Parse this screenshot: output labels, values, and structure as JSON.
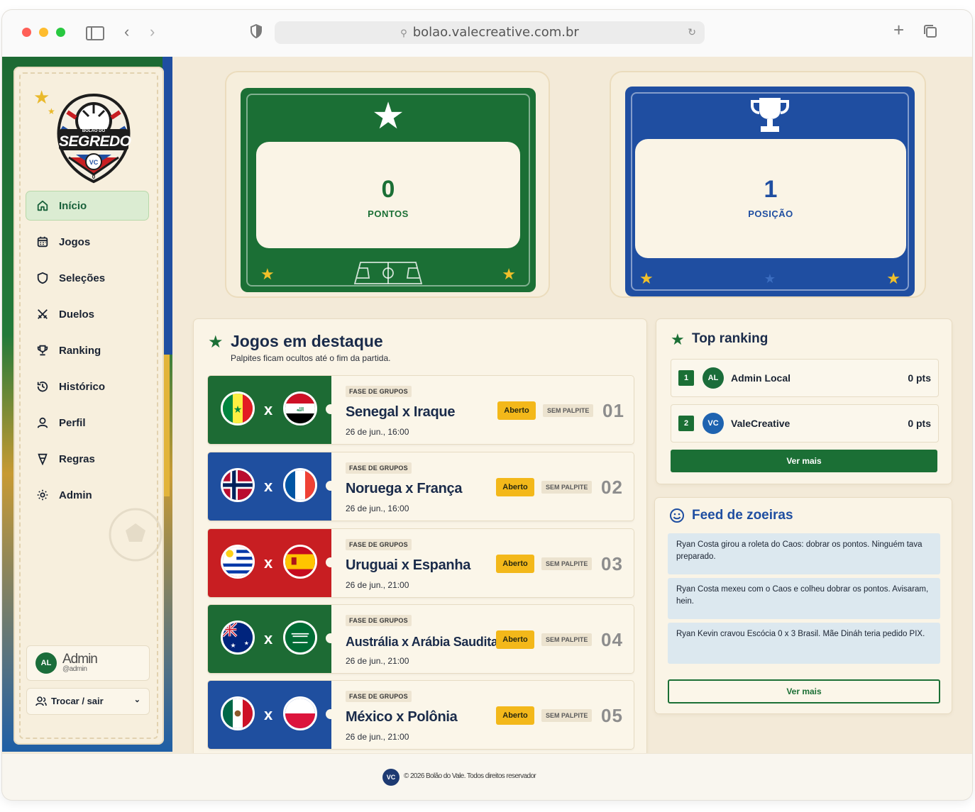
{
  "browser": {
    "url": "bolao.valecreative.com.br"
  },
  "brand": {
    "logo_text": "SEGREDO",
    "logo_top_text": "BOLÃO DO"
  },
  "sidebar": {
    "items": [
      {
        "label": "Início",
        "icon": "home-icon",
        "active": true
      },
      {
        "label": "Jogos",
        "icon": "calendar-icon"
      },
      {
        "label": "Seleções",
        "icon": "shield-icon"
      },
      {
        "label": "Duelos",
        "icon": "swords-icon"
      },
      {
        "label": "Ranking",
        "icon": "trophy-icon"
      },
      {
        "label": "Histórico",
        "icon": "history-icon"
      },
      {
        "label": "Perfil",
        "icon": "user-icon"
      },
      {
        "label": "Regras",
        "icon": "badge-icon"
      },
      {
        "label": "Admin",
        "icon": "gear-icon"
      }
    ],
    "user": {
      "initials": "AL",
      "name": "Admin",
      "handle": "@admin"
    },
    "switch_label": "Trocar / sair"
  },
  "stats": {
    "points": {
      "value": "0",
      "label": "PONTOS"
    },
    "position": {
      "value": "1",
      "label": "POSIÇÃO"
    }
  },
  "featured": {
    "title": "Jogos em destaque",
    "subtitle": "Palpites ficam ocultos até o fim da partida.",
    "games": [
      {
        "phase": "FASE DE GRUPOS",
        "match": "Senegal x Iraque",
        "kickoff": "26 de jun., 16:00",
        "status": "Aberto",
        "guess": "SEM PALPITE",
        "num": "01",
        "vs": "x"
      },
      {
        "phase": "FASE DE GRUPOS",
        "match": "Noruega x França",
        "kickoff": "26 de jun., 16:00",
        "status": "Aberto",
        "guess": "SEM PALPITE",
        "num": "02",
        "vs": "x"
      },
      {
        "phase": "FASE DE GRUPOS",
        "match": "Uruguai x Espanha",
        "kickoff": "26 de jun., 21:00",
        "status": "Aberto",
        "guess": "SEM PALPITE",
        "num": "03",
        "vs": "x"
      },
      {
        "phase": "FASE DE GRUPOS",
        "match": "Austrália x Arábia Saudita",
        "kickoff": "26 de jun., 21:00",
        "status": "Aberto",
        "guess": "SEM PALPITE",
        "num": "04",
        "vs": "x"
      },
      {
        "phase": "FASE DE GRUPOS",
        "match": "México x Polônia",
        "kickoff": "26 de jun., 21:00",
        "status": "Aberto",
        "guess": "SEM PALPITE",
        "num": "05",
        "vs": "x"
      }
    ]
  },
  "ranking": {
    "title": "Top ranking",
    "rows": [
      {
        "pos": "1",
        "initials": "AL",
        "name": "Admin Local",
        "pts": "0 pts"
      },
      {
        "pos": "2",
        "initials": "VC",
        "name": "ValeCreative",
        "pts": "0 pts"
      }
    ],
    "more": "Ver mais"
  },
  "feed": {
    "title": "Feed de zoeiras",
    "items": [
      "Ryan Costa girou a roleta do Caos: dobrar os pontos. Ninguém tava preparado.",
      "Ryan Costa mexeu com o Caos e colheu dobrar os pontos. Avisaram, hein.",
      "Ryan Kevin cravou Escócia 0 x 3 Brasil. Mãe Dináh teria pedido PIX."
    ],
    "more": "Ver mais"
  },
  "footer": {
    "logo": "VC",
    "copyright": "© 2026 Bolão do Vale. Todos direitos reservador"
  },
  "colors": {
    "green": "#1b6f35",
    "blue": "#1f4ea1",
    "red": "#c81e22",
    "yellow": "#f3b81a",
    "paper": "#f3ead8"
  }
}
